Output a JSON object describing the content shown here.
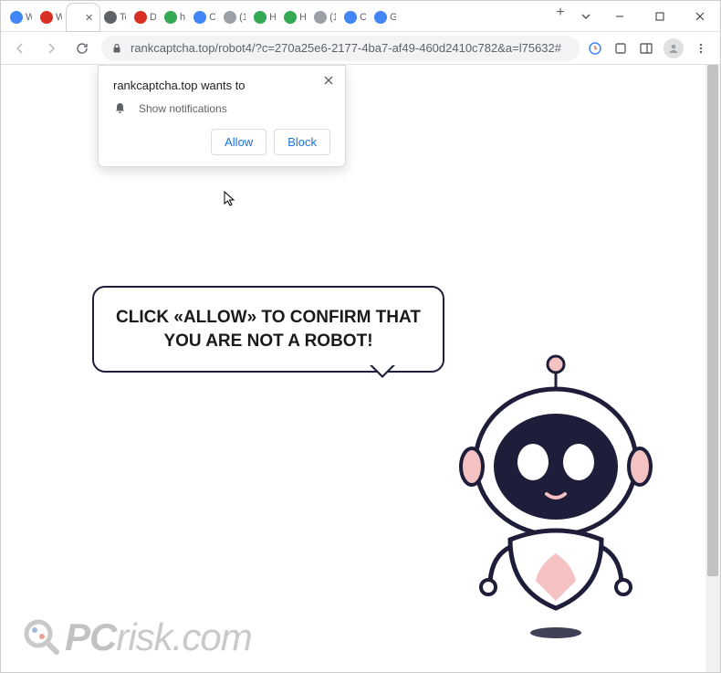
{
  "tabs": [
    {
      "label": "W",
      "favColor": "#4285f4"
    },
    {
      "label": "W",
      "favColor": "#d93025"
    },
    {
      "label": "",
      "favColor": "#fff",
      "active": true
    },
    {
      "label": "To",
      "favColor": "#5f6368"
    },
    {
      "label": "D",
      "favColor": "#d93025"
    },
    {
      "label": "h",
      "favColor": "#34a853"
    },
    {
      "label": "C",
      "favColor": "#4285f4"
    },
    {
      "label": "(1",
      "favColor": "#9aa0a6"
    },
    {
      "label": "H",
      "favColor": "#34a853"
    },
    {
      "label": "H",
      "favColor": "#34a853"
    },
    {
      "label": "(1",
      "favColor": "#9aa0a6"
    },
    {
      "label": "C",
      "favColor": "#4285f4"
    },
    {
      "label": "G",
      "favColor": "#4285f4"
    }
  ],
  "omnibox": {
    "url": "rankcaptcha.top/robot4/?c=270a25e6-2177-4ba7-af49-460d2410c782&a=l75632#"
  },
  "notification": {
    "title": "rankcaptcha.top wants to",
    "permission": "Show notifications",
    "allow": "Allow",
    "block": "Block"
  },
  "page": {
    "speech": "CLICK «ALLOW» TO CONFIRM THAT YOU ARE NOT A ROBOT!"
  },
  "watermark": {
    "p": "P",
    "c": "C",
    "rest": "risk.com"
  }
}
